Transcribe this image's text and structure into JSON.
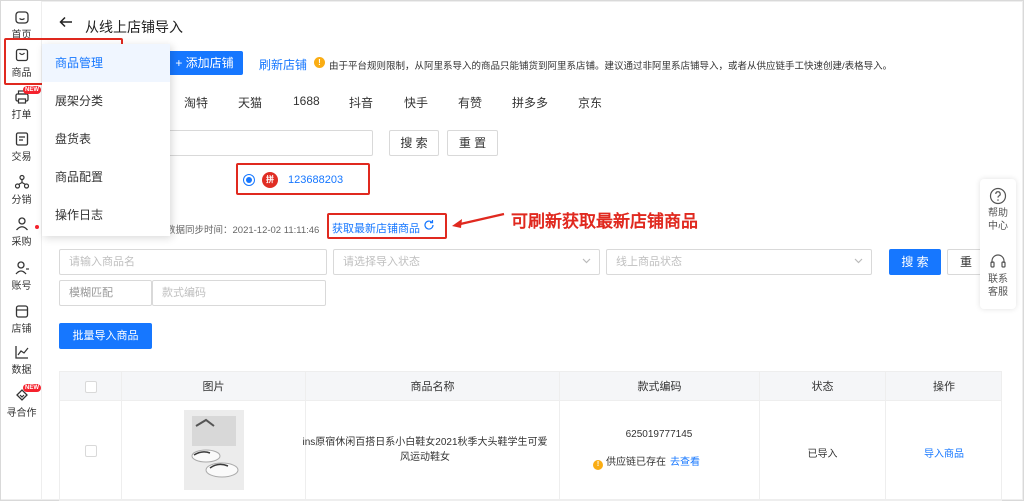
{
  "header": {
    "title": "从线上店铺导入"
  },
  "rail": {
    "items": [
      {
        "label": "首页",
        "icon": "home-icon"
      },
      {
        "label": "商品",
        "icon": "goods-icon"
      },
      {
        "label": "打单",
        "icon": "print-icon",
        "badge": "NEW"
      },
      {
        "label": "交易",
        "icon": "trade-icon"
      },
      {
        "label": "分销",
        "icon": "distribution-icon"
      },
      {
        "label": "采购",
        "icon": "purchase-icon"
      },
      {
        "label": "账号",
        "icon": "account-icon"
      },
      {
        "label": "店铺",
        "icon": "shop-icon"
      },
      {
        "label": "数据",
        "icon": "data-icon"
      },
      {
        "label": "寻合作",
        "icon": "cooperate-icon",
        "badge": "NEW"
      }
    ]
  },
  "flyout": {
    "items": [
      {
        "label": "商品管理"
      },
      {
        "label": "展架分类"
      },
      {
        "label": "盘货表"
      },
      {
        "label": "商品配置"
      },
      {
        "label": "操作日志"
      }
    ]
  },
  "toolbar": {
    "add_shop": "+ 添加店铺",
    "refresh_shop": "刷新店铺",
    "notice": "由于平台规则限制，从阿里系导入的商品只能铺货到阿里系店铺。建议通过非阿里系店铺导入，或者从供应链手工快速创建/表格导入。"
  },
  "platform_tabs": [
    "淘特",
    "天猫",
    "1688",
    "抖音",
    "快手",
    "有赞",
    "拼多多",
    "京东"
  ],
  "shop_search": {
    "search": "搜 索",
    "reset": "重 置"
  },
  "shop": {
    "logo_text": "拼",
    "id": "123688203"
  },
  "sync": {
    "time_label": "数据同步时间：2021-12-02 11:11:46",
    "fetch_link": "获取最新店铺商品",
    "annotation": "可刷新获取最新店铺商品"
  },
  "filters": {
    "name_placeholder": "请输入商品名",
    "import_status_placeholder": "请选择导入状态",
    "online_status_placeholder": "线上商品状态",
    "search": "搜 索",
    "reset": "重 置",
    "match_mode": "模糊匹配",
    "code_placeholder": "款式编码"
  },
  "bulk_import": "批量导入商品",
  "float_panel": {
    "help": "帮助中心",
    "service": "联系客服"
  },
  "table": {
    "headers": [
      "",
      "图片",
      "商品名称",
      "款式编码",
      "状态",
      "操作"
    ],
    "rows": [
      {
        "name": "ins原宿休闲百搭日系小白鞋女2021秋季大头鞋学生可爱风运动鞋女",
        "code": "625019777145",
        "supply_note": "供应链已存在",
        "supply_link": "去查看",
        "status": "已导入",
        "action": "导入商品"
      }
    ]
  },
  "colors": {
    "primary": "#1677ff",
    "annotation": "#e0291f",
    "warning": "#faad14"
  }
}
